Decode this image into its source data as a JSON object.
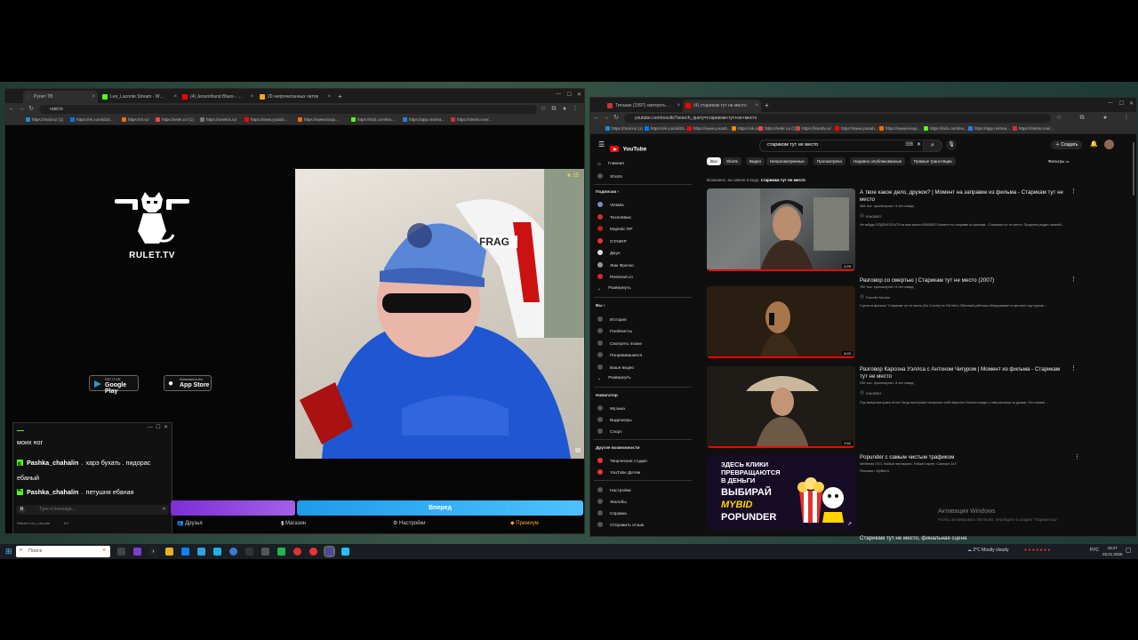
{
  "left_browser": {
    "tabs": [
      {
        "label": "Рулет ТВ",
        "active": true
      },
      {
        "label": "Leo_Laconte Stream - Watch Li",
        "active": false
      },
      {
        "label": "(4) Jensonhurst Blues - Осно 1",
        "active": false
      },
      {
        "label": "20 непрочитанных чатов",
        "active": false
      }
    ],
    "url": "rulet.tv",
    "bookmarks": [
      "https://mail.ru/ (1)",
      "https://vk.com/id15...",
      "https://vt.ru/",
      "https://wink.ru/ (1)",
      "https://onetick.ru/",
      "https://www.youtub...",
      "https://www.kinop...",
      "https://kick.com/leo...",
      "https://app.restrea...",
      "https://steimo.me/..."
    ]
  },
  "rulet": {
    "logo_text": "RULET.TV",
    "google_play": {
      "small": "GET IT ON",
      "big": "Google Play"
    },
    "app_store": {
      "small": "Download on the",
      "big": "App Store"
    },
    "viewer_count": "25",
    "next_button": "Вперед"
  },
  "chat": {
    "lines": [
      {
        "text": "моих ног"
      },
      {
        "user": "Pashka_chahalin",
        "message": "харэ бухать . пидорас ебаный"
      },
      {
        "user": "Pashka_chahalin",
        "message": "петушня ебаная"
      }
    ],
    "input_placeholder": "Type a message...",
    "footer_user": "Stream Leo_Laconte",
    "footer_count": "0/1"
  },
  "left_bottom_nav": [
    "Друзья",
    "Магазин",
    "Настройки",
    "Премиум"
  ],
  "right_browser": {
    "tabs": [
      {
        "label": "Титаник (1997) смотреть онл",
        "active": false
      },
      {
        "label": "(4) стариком тут не место",
        "active": true
      }
    ],
    "url": "youtube.com/results?search_query=стариком+тут+не+место",
    "bookmarks": [
      "https://mail.ru/ (1)",
      "https://vk.com/id15...",
      "https://www.youtub...",
      "https://ok.ru/",
      "https://wink.ru/ (1)",
      "https://lion4tv.ru/",
      "https://www.youtub...",
      "https://www.kinop...",
      "https://kick.com/leo...",
      "https://app.restrea...",
      "https://steimo.me/..."
    ]
  },
  "youtube": {
    "logo": "YouTube",
    "search_query": "стариком тут не место",
    "create_label": "Создать",
    "filters_label": "Фильтры",
    "chips": [
      "Все",
      "Shorts",
      "Видео",
      "Непросмотренные",
      "Просмотрено",
      "Недавно опубликованные",
      "Прямые трансляции"
    ],
    "suggestion": {
      "prefix": "Возможно, вы имели в виду:",
      "query": "старикам тут не место"
    },
    "sidebar": {
      "main": [
        "Главная",
        "Shorts"
      ],
      "subs_header": "Подписки",
      "subs": [
        "Vistaka",
        "ТехноМикс",
        "Majestic RP",
        "GTA5RP",
        "Джун",
        "Жак Фреско",
        "Restream.io",
        "Развернуть"
      ],
      "you_header": "Вы",
      "you": [
        "История",
        "Плейлисты",
        "Смотреть позже",
        "Понравившиеся",
        "Ваше видео",
        "Развернуть"
      ],
      "nav_header": "Навигатор",
      "nav": [
        "Музыка",
        "Видеоигры",
        "Спорт"
      ],
      "more_header": "Другие возможности",
      "more": [
        "Творческая студия",
        "YouTube Детям"
      ],
      "bottom": [
        "Настройки",
        "Жалобы",
        "Справка",
        "Отправить отзыв"
      ]
    },
    "videos": [
      {
        "title": "А твое какое дело, дружок? | Момент на заправке из фильма - Старикам тут не место",
        "meta": "386 тыс. просмотров • 3 лет назад",
        "channel": "KINOBEO",
        "desc": "Не забудь ПОДПИСАТЬСЯ на наш канал KINOBEO! Момент на заправке из фильма - Старикам тут не место. Проделец видал лишний...",
        "duration": "4:29"
      },
      {
        "title": "Разговор со смертью | Старикам тут не место (2007)",
        "meta": "760 тыс. просмотров • 5 лет назад",
        "channel": "Favorite Movies",
        "desc": "Сцена из фильма \"Старикам тут не место (No Country for Old Men) Обычный работяга обнаруживает в пустыне гору трупов ...",
        "duration": "6:03"
      },
      {
        "title": "Разговор Карсона Уэллса с Антоном Чигуром | Момент из фильма - Старикам тут не место",
        "meta": "336 тыс. просмотров • 3 лет назад",
        "channel": "KINOBEO",
        "desc": "Под прицелом ружья Антон Чигур выслушает непрошен себя Карсона Уэллса и видит к ним разговор по душам. Это первая ...",
        "duration": "2:52"
      }
    ],
    "ad": {
      "title": "Popunder с самым чистым трафиком",
      "desc": "Webfords ГЕО, Любые вертикали, Гибкий таргет, Саппорт 24/7",
      "sponsor": "Реклама • MyBid.io",
      "line1": "ЗДЕСЬ КЛИКИ",
      "line2": "ПРЕВРАЩАЮТСЯ",
      "line3": "В ДЕНЬГИ",
      "line4": "ВЫБИРАЙ",
      "brand1": "MYBID",
      "brand2": "POPUNDER"
    },
    "next_title": "Старикам тут не место, финальная сцена"
  },
  "activation": {
    "title": "Активация Windows",
    "sub": "Чтобы активировать Windows, перейдите в раздел \"Параметры\"."
  },
  "taskbar": {
    "search": "Поиск",
    "weather": "2°C Mostly cloudy",
    "lang": "РУС",
    "time": "19:47",
    "date": "03.01.2025"
  }
}
